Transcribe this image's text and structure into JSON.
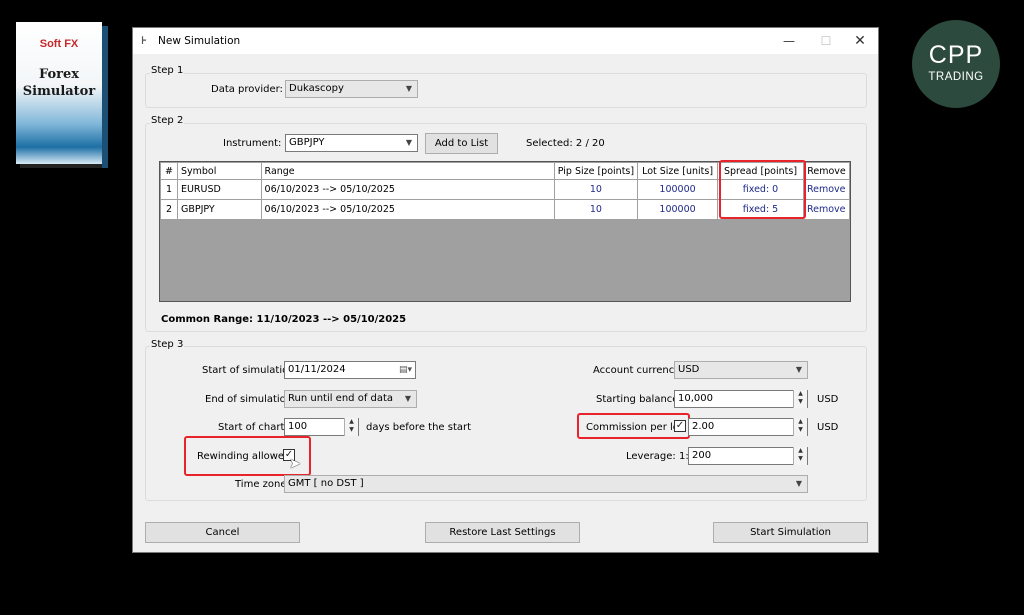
{
  "product": {
    "brand": "Soft FX",
    "title_line1": "Forex",
    "title_line2": "Simulator"
  },
  "badge": {
    "line1": "CPP",
    "line2": "TRADING"
  },
  "window": {
    "title": "New Simulation",
    "minimize": "—",
    "maximize": "☐",
    "close": "✕"
  },
  "step1": {
    "label": "Step 1",
    "data_provider_label": "Data provider:",
    "data_provider_value": "Dukascopy"
  },
  "step2": {
    "label": "Step 2",
    "instrument_label": "Instrument:",
    "instrument_value": "GBPJPY",
    "add_to_list": "Add to List",
    "selected": "Selected: 2 / 20",
    "columns": [
      "#",
      "Symbol",
      "Range",
      "Pip Size [points]",
      "Lot Size [units]",
      "Spread [points]",
      "Remove"
    ],
    "rows": [
      {
        "index": "1",
        "symbol": "EURUSD",
        "range": "06/10/2023 --> 05/10/2025",
        "pip_size": "10",
        "lot_size": "100000",
        "spread": "fixed: 0",
        "remove": "Remove"
      },
      {
        "index": "2",
        "symbol": "GBPJPY",
        "range": "06/10/2023 --> 05/10/2025",
        "pip_size": "10",
        "lot_size": "100000",
        "spread": "fixed: 5",
        "remove": "Remove"
      }
    ],
    "common_range": "Common Range: 11/10/2023 --> 05/10/2025"
  },
  "step3": {
    "label": "Step 3",
    "start_sim_label": "Start of simulation:",
    "start_sim_value": "01/11/2024",
    "end_sim_label": "End of simulation:",
    "end_sim_value": "Run until end of data",
    "start_charts_label": "Start of charts:",
    "start_charts_value": "100",
    "start_charts_suffix": "days before the start",
    "rewinding_label": "Rewinding allowed:",
    "rewinding_checked": "✓",
    "time_zone_label": "Time zone:",
    "time_zone_value": "GMT [ no DST ]",
    "account_currency_label": "Account currency:",
    "account_currency_value": "USD",
    "starting_balance_label": "Starting balance:",
    "starting_balance_value": "10,000",
    "starting_balance_unit": "USD",
    "commission_label": "Commission per lot:",
    "commission_checked": "✓",
    "commission_value": "2.00",
    "commission_unit": "USD",
    "leverage_label": "Leverage:",
    "leverage_prefix": "1:",
    "leverage_value": "200"
  },
  "buttons": {
    "cancel": "Cancel",
    "restore": "Restore Last Settings",
    "start": "Start Simulation"
  },
  "colors": {
    "highlight": "#e8242a",
    "link": "#1f2a8a",
    "badge_bg": "#2d4a3e"
  }
}
